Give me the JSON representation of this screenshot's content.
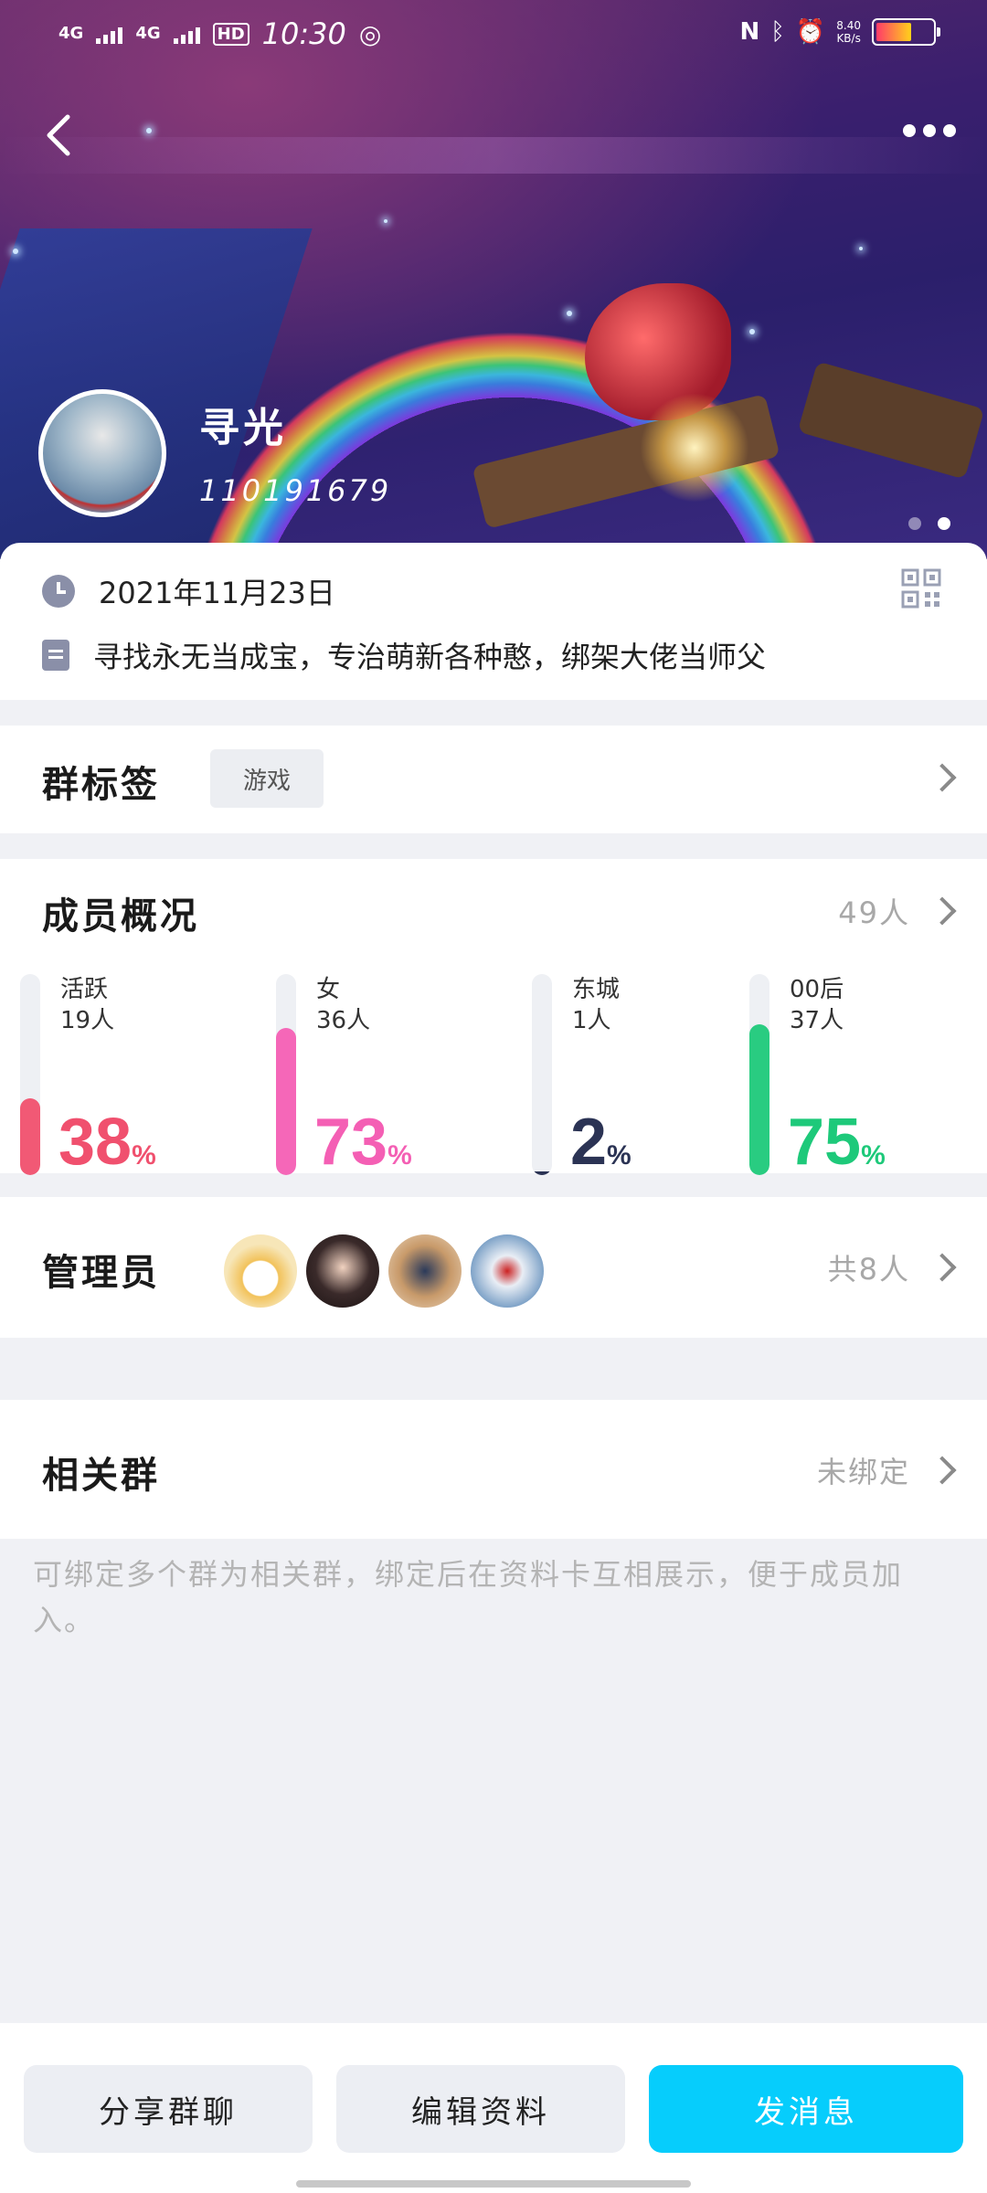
{
  "status_bar": {
    "network1": "4G",
    "network2": "4G",
    "hd": "HD",
    "time": "10:30",
    "speed_top": "8.40",
    "speed_bottom": "KB/s"
  },
  "group": {
    "name": "寻光",
    "id": "110191679",
    "created": "2021年11月23日",
    "description": "寻找永无当成宝，专治萌新各种憨，绑架大佬当师父"
  },
  "tags": {
    "title": "群标签",
    "items": [
      "游戏"
    ]
  },
  "members": {
    "title": "成员概况",
    "total": "49人",
    "stats": [
      {
        "label": "活跃",
        "count": "19人",
        "percent": 38,
        "percent_text": "38",
        "color": "#f0506e"
      },
      {
        "label": "女",
        "count": "36人",
        "percent": 73,
        "percent_text": "73",
        "color": "#f45fb4"
      },
      {
        "label": "东城",
        "count": "1人",
        "percent": 2,
        "percent_text": "2",
        "color": "#2b3354"
      },
      {
        "label": "00后",
        "count": "37人",
        "percent": 75,
        "percent_text": "75",
        "color": "#1ec97a"
      }
    ],
    "percent_sign": "%"
  },
  "admins": {
    "title": "管理员",
    "count": "共8人"
  },
  "related": {
    "title": "相关群",
    "status": "未绑定",
    "hint": "可绑定多个群为相关群，绑定后在资料卡互相展示，便于成员加入。"
  },
  "actions": {
    "share": "分享群聊",
    "edit": "编辑资料",
    "message": "发消息"
  },
  "colors": {
    "primary": "#06cdfc",
    "background": "#f0f1f5"
  }
}
